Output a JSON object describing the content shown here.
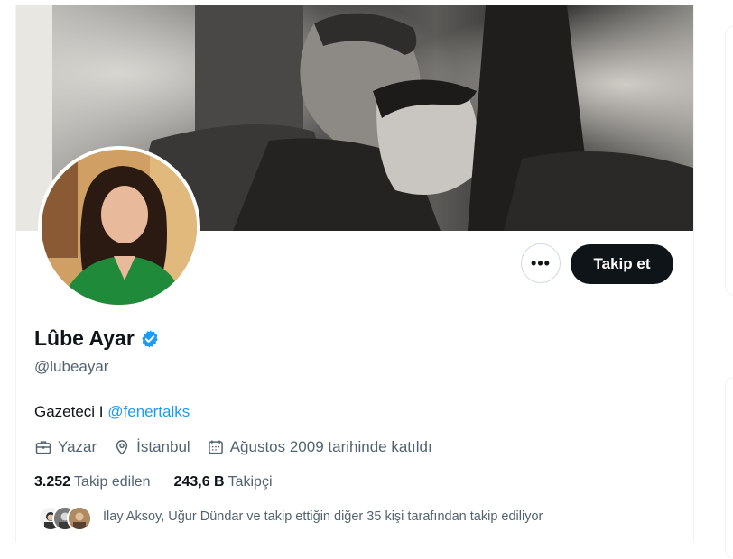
{
  "profile": {
    "display_name": "Lûbe Ayar",
    "handle": "@lubeayar",
    "bio_text": "Gazeteci I ",
    "bio_link": "@fenertalks",
    "profession": "Yazar",
    "location": "İstanbul",
    "joined": "Ağustos 2009 tarihinde katıldı"
  },
  "actions": {
    "more_label": "•••",
    "follow_label": "Takip et"
  },
  "stats": {
    "following_count": "3.252",
    "following_label": "Takip edilen",
    "followers_count": "243,6 B",
    "followers_label": "Takipçi"
  },
  "followed_by": {
    "text": "İlay Aksoy, Uğur Dündar ve takip ettiğin diğer 35 kişi tarafından takip ediliyor"
  },
  "colors": {
    "link": "#1d9bf0",
    "follow_bg": "#0f1419",
    "secondary_text": "#536471",
    "verified_badge": "#1d9bf0"
  },
  "icons": [
    "more-icon",
    "verified-badge-icon",
    "briefcase-icon",
    "location-pin-icon",
    "calendar-icon"
  ]
}
